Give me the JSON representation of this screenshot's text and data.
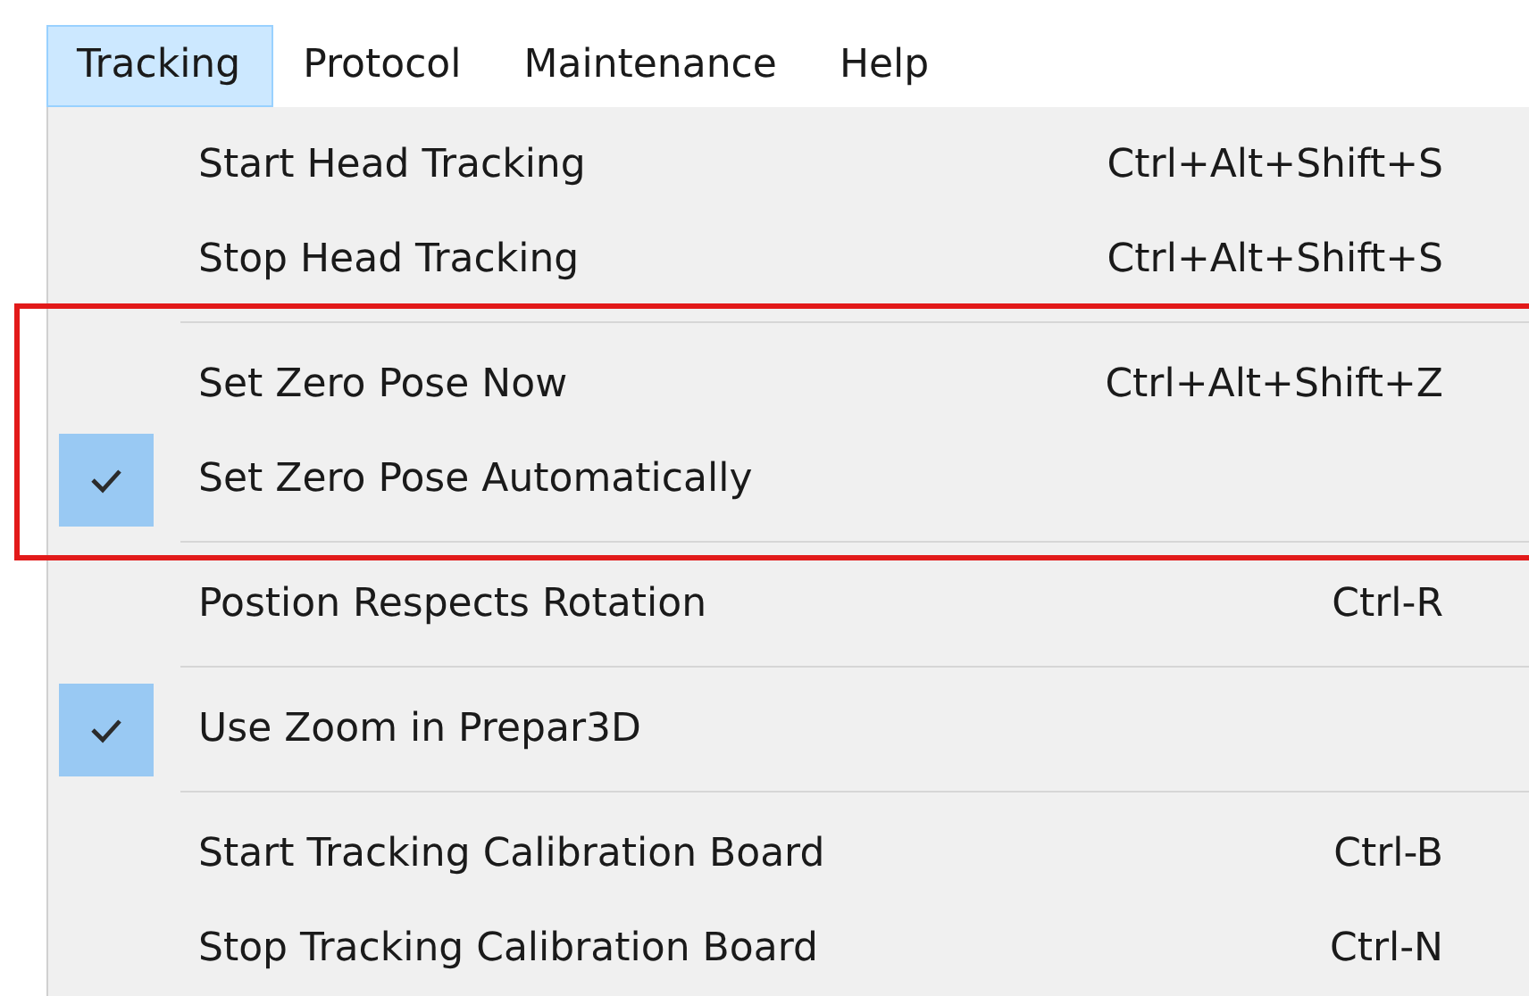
{
  "menubar": [
    {
      "label": "Tracking",
      "selected": true
    },
    {
      "label": "Protocol",
      "selected": false
    },
    {
      "label": "Maintenance",
      "selected": false
    },
    {
      "label": "Help",
      "selected": false
    }
  ],
  "menu": {
    "sections": [
      {
        "highlighted": false,
        "items": [
          {
            "label": "Start Head Tracking",
            "shortcut": "Ctrl+Alt+Shift+S",
            "checked": false
          },
          {
            "label": "Stop Head Tracking",
            "shortcut": "Ctrl+Alt+Shift+S",
            "checked": false
          }
        ]
      },
      {
        "highlighted": true,
        "items": [
          {
            "label": "Set Zero Pose Now",
            "shortcut": "Ctrl+Alt+Shift+Z",
            "checked": false
          },
          {
            "label": "Set Zero Pose Automatically",
            "checked": true
          }
        ]
      },
      {
        "highlighted": false,
        "items": [
          {
            "label": "Postion Respects Rotation",
            "shortcut": "Ctrl-R",
            "checked": false
          }
        ]
      },
      {
        "highlighted": false,
        "items": [
          {
            "label": "Use Zoom in Prepar3D",
            "checked": true
          }
        ]
      },
      {
        "highlighted": false,
        "items": [
          {
            "label": "Start Tracking Calibration Board",
            "shortcut": "Ctrl-B",
            "checked": false
          },
          {
            "label": "Stop Tracking Calibration Board",
            "shortcut": "Ctrl-N",
            "checked": false
          }
        ]
      }
    ]
  }
}
